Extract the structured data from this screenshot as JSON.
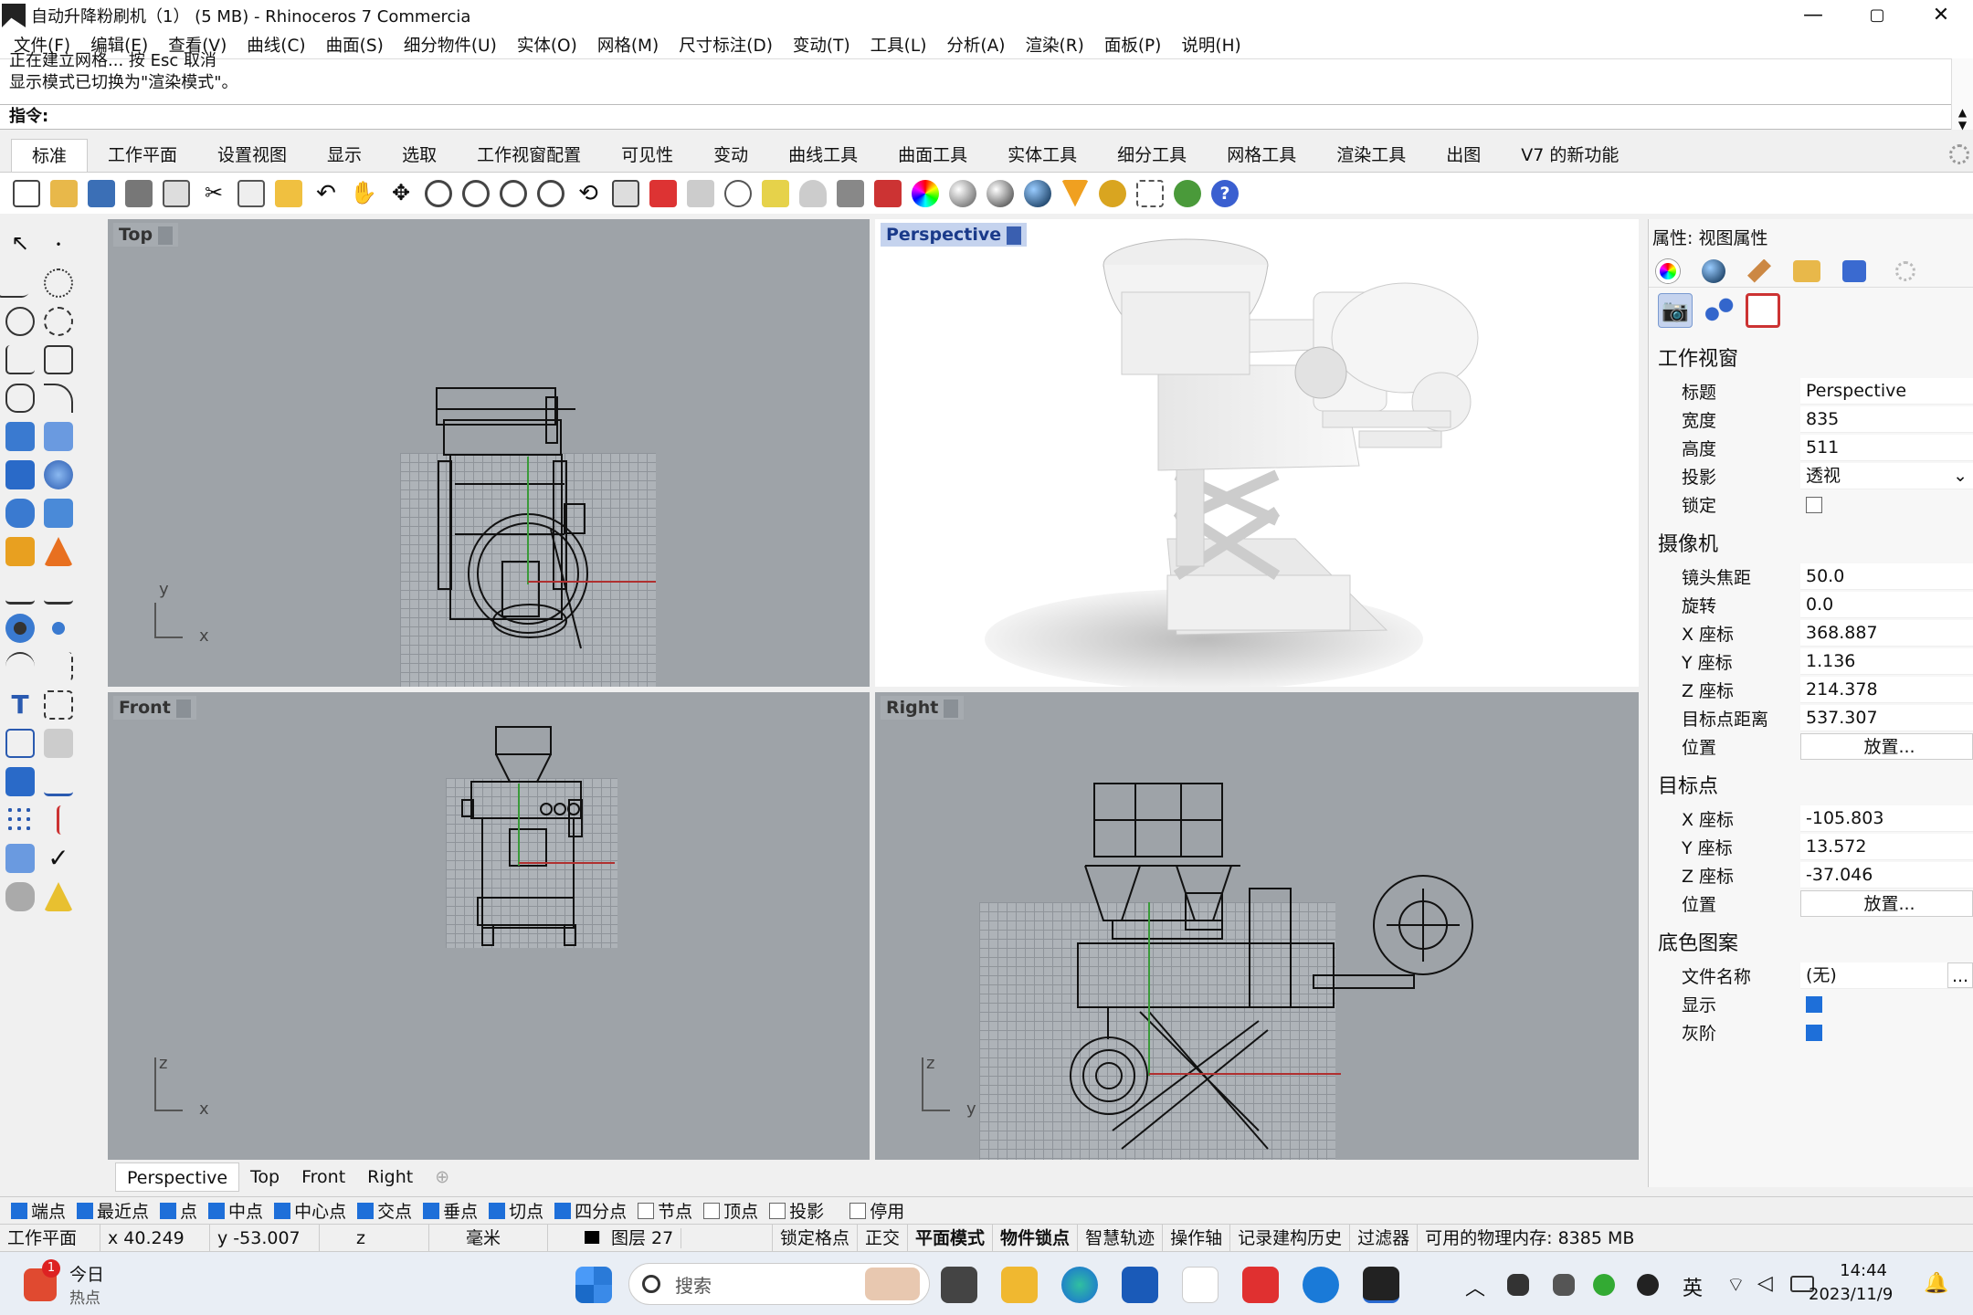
{
  "title": "自动升降粉刷机（1） (5 MB) - Rhinoceros 7 Commercia",
  "window_buttons": [
    "—",
    "▢",
    "✕"
  ],
  "menus": [
    "文件(F)",
    "编辑(E)",
    "查看(V)",
    "曲线(C)",
    "曲面(S)",
    "细分物件(U)",
    "实体(O)",
    "网格(M)",
    "尺寸标注(D)",
    "变动(T)",
    "工具(L)",
    "分析(A)",
    "渲染(R)",
    "面板(P)",
    "说明(H)"
  ],
  "command_history": [
    "正在建立网格... 按 Esc 取消",
    "显示模式已切换为\"渲染模式\"。"
  ],
  "command_prompt": "指令:",
  "tabs": [
    "标准",
    "工作平面",
    "设置视图",
    "显示",
    "选取",
    "工作视窗配置",
    "可见性",
    "变动",
    "曲线工具",
    "曲面工具",
    "实体工具",
    "细分工具",
    "网格工具",
    "渲染工具",
    "出图",
    "V7 的新功能"
  ],
  "active_tab": "标准",
  "viewports": {
    "top": {
      "label": "Top",
      "axis_y": "y",
      "axis_x": "x"
    },
    "perspective": {
      "label": "Perspective"
    },
    "front": {
      "label": "Front",
      "axis_y": "z",
      "axis_x": "x"
    },
    "right": {
      "label": "Right",
      "axis_y": "z",
      "axis_x": "y"
    }
  },
  "viewport_tabs": [
    "Perspective",
    "Top",
    "Front",
    "Right",
    "⊕"
  ],
  "panel": {
    "header": "属性: 视图属性",
    "section_viewport": "工作视窗",
    "title_label": "标题",
    "title_value": "Perspective",
    "width_label": "宽度",
    "width_value": "835",
    "height_label": "高度",
    "height_value": "511",
    "projection_label": "投影",
    "projection_value": "透视",
    "lock_label": "锁定",
    "section_camera": "摄像机",
    "focal_label": "镜头焦距",
    "focal_value": "50.0",
    "rotation_label": "旋转",
    "rotation_value": "0.0",
    "cam_x_label": "X 座标",
    "cam_x_value": "368.887",
    "cam_y_label": "Y 座标",
    "cam_y_value": "1.136",
    "cam_z_label": "Z 座标",
    "cam_z_value": "214.378",
    "target_dist_label": "目标点距离",
    "target_dist_value": "537.307",
    "cam_pos_label": "位置",
    "place_button": "放置...",
    "section_target": "目标点",
    "tgt_x_label": "X 座标",
    "tgt_x_value": "-105.803",
    "tgt_y_label": "Y 座标",
    "tgt_y_value": "13.572",
    "tgt_z_label": "Z 座标",
    "tgt_z_value": "-37.046",
    "tgt_pos_label": "位置",
    "section_wallpaper": "底色图案",
    "file_label": "文件名称",
    "file_value": "(无)",
    "file_browse": "...",
    "show_label": "显示",
    "gray_label": "灰阶"
  },
  "osnaps": [
    {
      "label": "端点",
      "checked": true
    },
    {
      "label": "最近点",
      "checked": true
    },
    {
      "label": "点",
      "checked": true
    },
    {
      "label": "中点",
      "checked": true
    },
    {
      "label": "中心点",
      "checked": true
    },
    {
      "label": "交点",
      "checked": true
    },
    {
      "label": "垂点",
      "checked": true
    },
    {
      "label": "切点",
      "checked": true
    },
    {
      "label": "四分点",
      "checked": true
    },
    {
      "label": "节点",
      "checked": false
    },
    {
      "label": "顶点",
      "checked": false
    },
    {
      "label": "投影",
      "checked": false
    },
    {
      "label": "停用",
      "checked": false
    }
  ],
  "status": [
    "工作平面",
    "x 40.249",
    "y -53.007",
    "z",
    "毫米",
    "图层 27",
    "锁定格点",
    "正交",
    "平面模式",
    "物件锁点",
    "智慧轨迹",
    "操作轴",
    "记录建构历史",
    "过滤器",
    "可用的物理内存: 8385 MB"
  ],
  "taskbar": {
    "news_title": "今日",
    "news_sub": "热点",
    "badge": "1",
    "search_placeholder": "搜索",
    "ime": "英",
    "time": "14:44",
    "date": "2023/11/9"
  }
}
